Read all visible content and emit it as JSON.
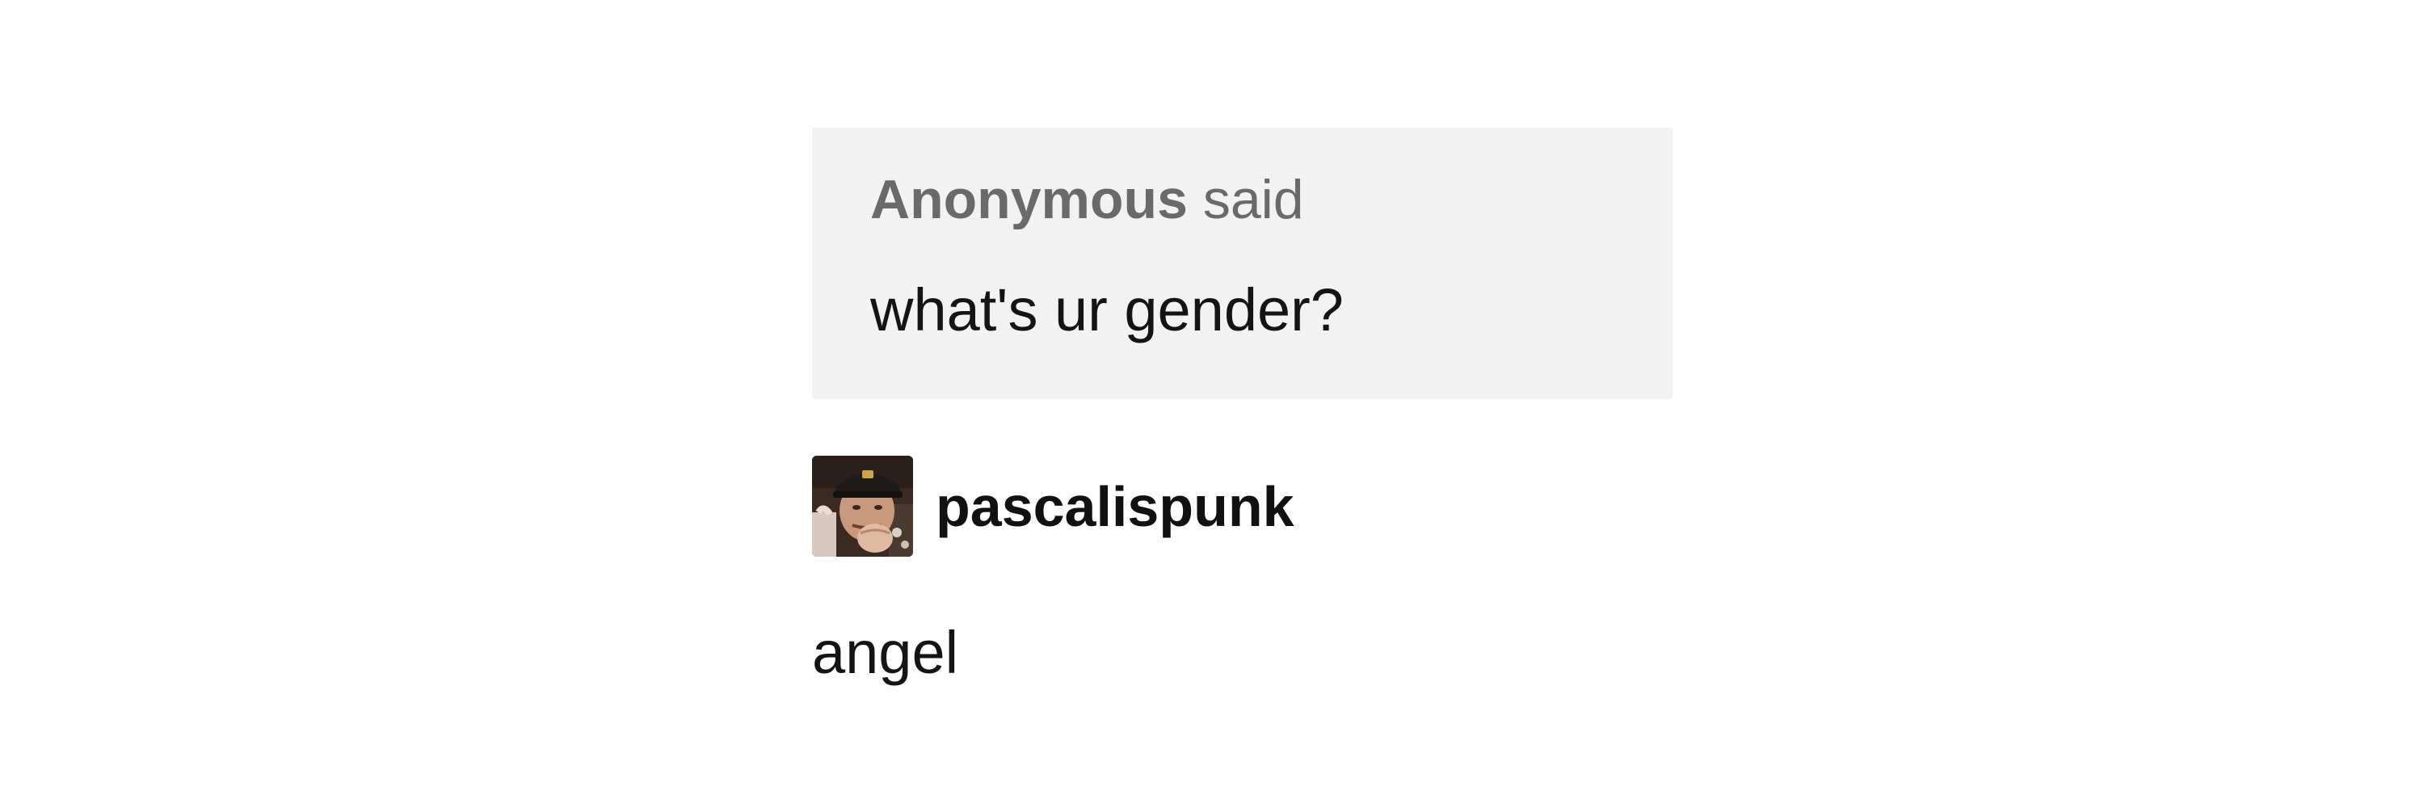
{
  "ask": {
    "asker": "Anonymous",
    "verb": "said",
    "question": "what's ur gender?"
  },
  "answer": {
    "avatar_icon": "user-avatar",
    "username": "pascalispunk",
    "text": "angel"
  },
  "colors": {
    "ask_background": "#f2f2f2",
    "asker_text": "#6a6a6a",
    "body_text": "#141414",
    "page_background": "#ffffff"
  }
}
